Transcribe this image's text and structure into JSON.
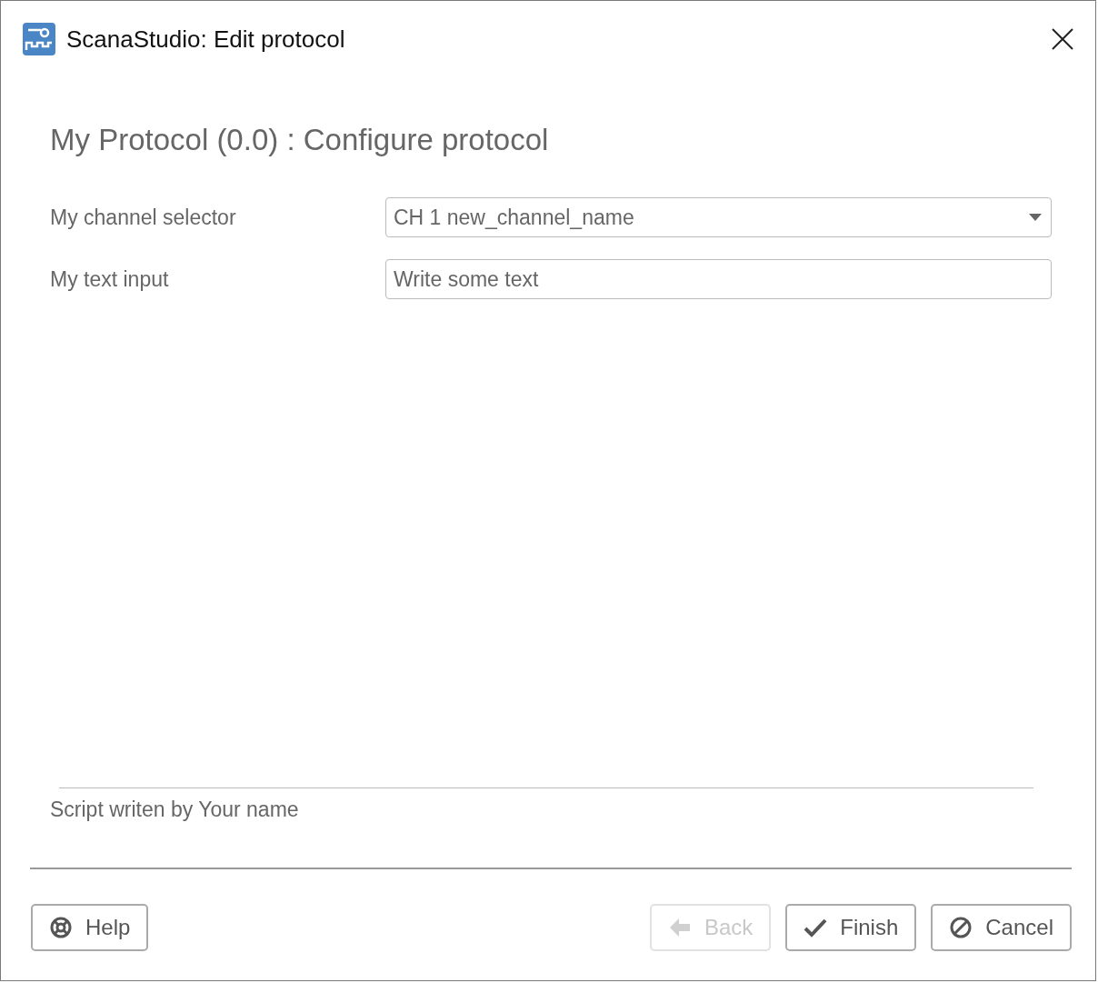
{
  "window": {
    "title": "ScanaStudio: Edit protocol"
  },
  "heading": "My Protocol (0.0) : Configure protocol",
  "fields": [
    {
      "kind": "select",
      "label": "My channel selector",
      "value": "CH 1 new_channel_name"
    },
    {
      "kind": "text",
      "label": "My text input",
      "value": "Write some text"
    }
  ],
  "footer_note": "Script writen by Your name",
  "buttons": [
    {
      "kind": "help",
      "label": "Help",
      "disabled": false
    },
    {
      "kind": "back",
      "label": "Back",
      "disabled": true
    },
    {
      "kind": "finish",
      "label": "Finish",
      "disabled": false
    },
    {
      "kind": "cancel",
      "label": "Cancel",
      "disabled": false
    }
  ]
}
